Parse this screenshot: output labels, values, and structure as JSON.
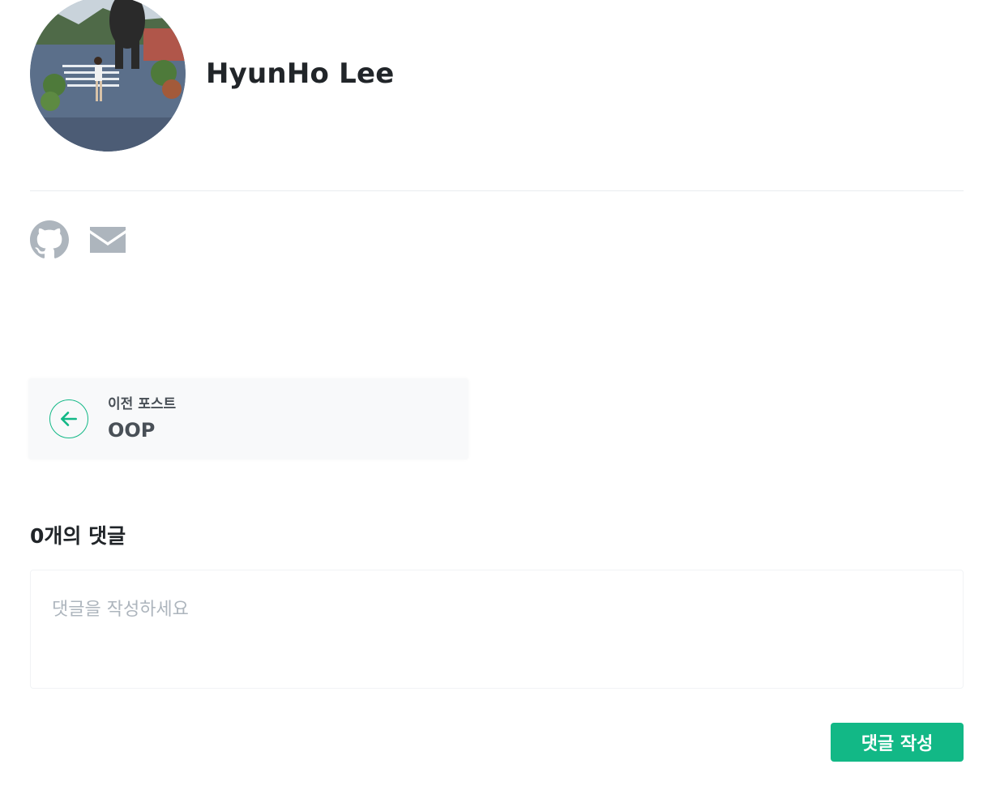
{
  "author": {
    "name": "HyunHo Lee",
    "avatar_icon": "profile-photo"
  },
  "social": [
    {
      "icon": "github-icon"
    },
    {
      "icon": "mail-icon"
    }
  ],
  "prev_post": {
    "label": "이전 포스트",
    "title": "OOP",
    "icon": "arrow-left-icon",
    "accent": "#12b886"
  },
  "comments": {
    "count_label": "0개의 댓글",
    "placeholder": "댓글을 작성하세요",
    "submit_label": "댓글 작성"
  },
  "colors": {
    "accent": "#12b886",
    "icon_gray": "#adb5bd",
    "text": "#212529"
  }
}
